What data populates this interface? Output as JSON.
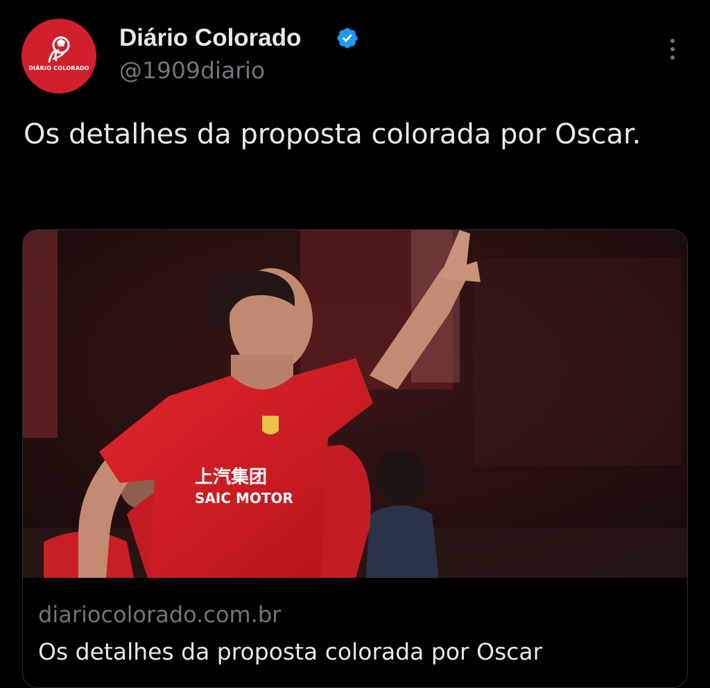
{
  "author": {
    "display_name": "Diário Colorado",
    "handle": "@1909diario",
    "avatar_text": "DIÁRIO COLORADO",
    "verified": true,
    "avatar_color": "#d0202e"
  },
  "tweet": {
    "text": "Os detalhes da proposta colorada por Oscar."
  },
  "card": {
    "domain": "diariocolorado.com.br",
    "title": "Os detalhes da proposta colorada por Oscar",
    "image_content": {
      "jersey_text_cn": "上汽集团",
      "jersey_text": "SAIC MOTOR"
    }
  },
  "colors": {
    "background": "#000000",
    "primary_text": "#e7e9ea",
    "secondary_text": "#71767b",
    "verified_badge": "#1d9bf0",
    "card_border": "#2f3336"
  },
  "icons": {
    "verified": "verified-badge-icon",
    "more": "more-vertical-icon"
  }
}
